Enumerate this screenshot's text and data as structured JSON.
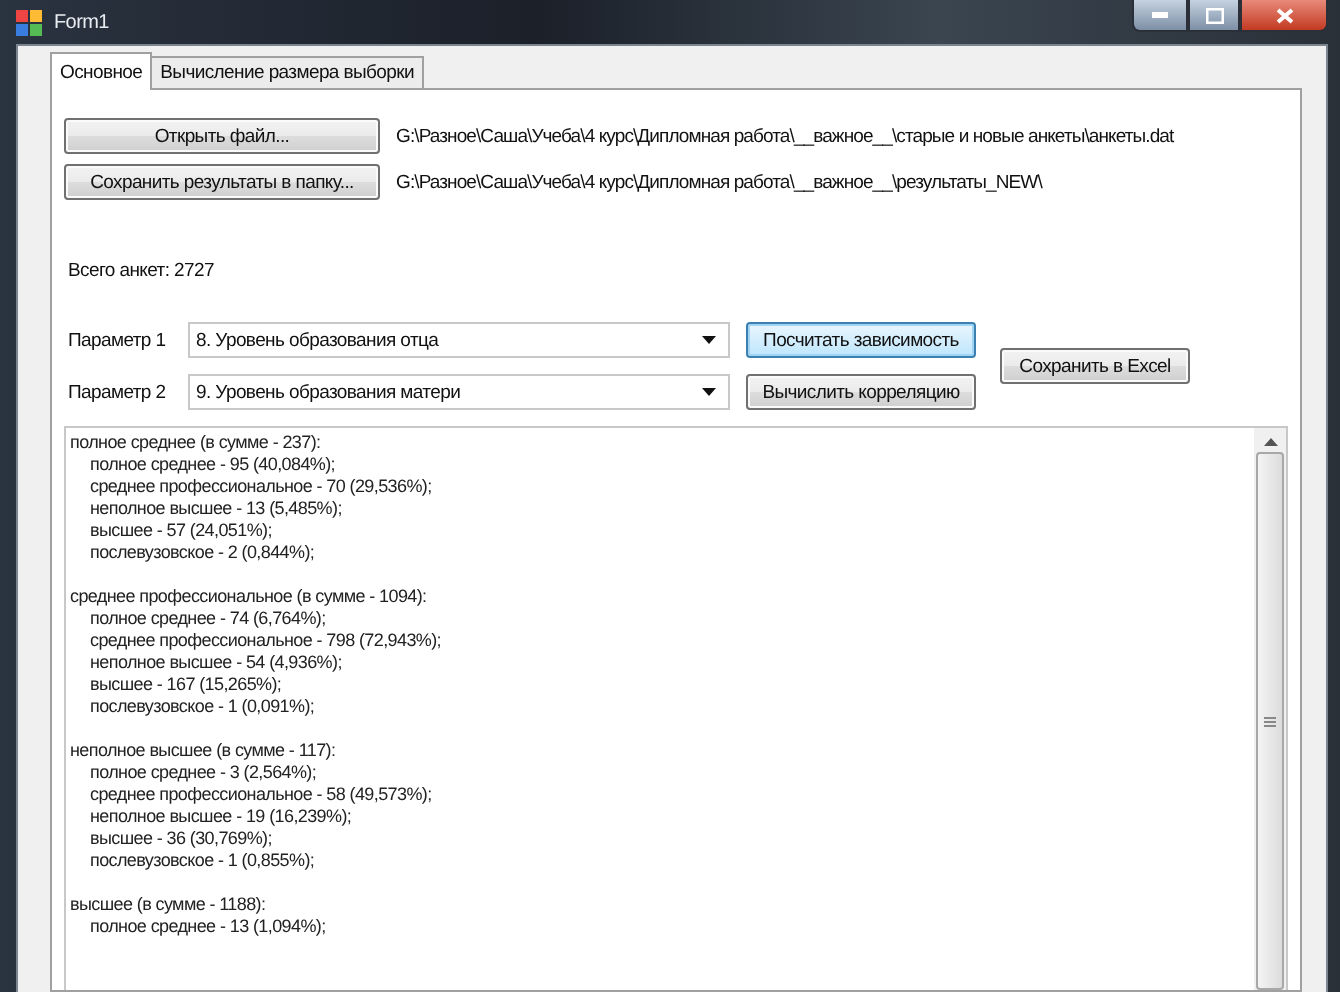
{
  "window": {
    "title": "Form1"
  },
  "tabs": [
    {
      "label": "Основное",
      "selected": true
    },
    {
      "label": "Вычисление размера выборки",
      "selected": false
    }
  ],
  "file_rows": [
    {
      "button": "Открыть файл...",
      "path": "G:\\Разное\\Саша\\Учеба\\4 курс\\Дипломная работа\\__важное__\\старые и новые анкеты\\анкеты.dat"
    },
    {
      "button": "Сохранить результаты в папку...",
      "path": "G:\\Разное\\Саша\\Учеба\\4 курс\\Дипломная работа\\__важное__\\результаты_NEW\\"
    }
  ],
  "total": "Всего анкет: 2727",
  "params": [
    {
      "label": "Параметр 1",
      "value": "8. Уровень образования отца",
      "button": "Посчитать зависимость",
      "focused": true
    },
    {
      "label": "Параметр 2",
      "value": "9. Уровень образования матери",
      "button": "Вычислить корреляцию",
      "focused": false
    }
  ],
  "excel_button": "Сохранить в Excel",
  "results": [
    {
      "title": "полное среднее (в сумме - 237):",
      "items": [
        "полное среднее - 95 (40,084%);",
        "среднее профессиональное - 70 (29,536%);",
        "неполное высшее - 13 (5,485%);",
        "высшее - 57 (24,051%);",
        "послевузовское - 2 (0,844%);"
      ]
    },
    {
      "title": "среднее профессиональное (в сумме - 1094):",
      "items": [
        "полное среднее - 74 (6,764%);",
        "среднее профессиональное - 798 (72,943%);",
        "неполное высшее - 54 (4,936%);",
        "высшее - 167 (15,265%);",
        "послевузовское - 1 (0,091%);"
      ]
    },
    {
      "title": "неполное высшее (в сумме - 117):",
      "items": [
        "полное среднее - 3 (2,564%);",
        "среднее профессиональное - 58 (49,573%);",
        "неполное высшее - 19 (16,239%);",
        "высшее - 36 (30,769%);",
        "послевузовское - 1 (0,855%);"
      ]
    },
    {
      "title": "высшее (в сумме - 1188):",
      "items": [
        "полное среднее - 13 (1,094%);"
      ]
    }
  ]
}
